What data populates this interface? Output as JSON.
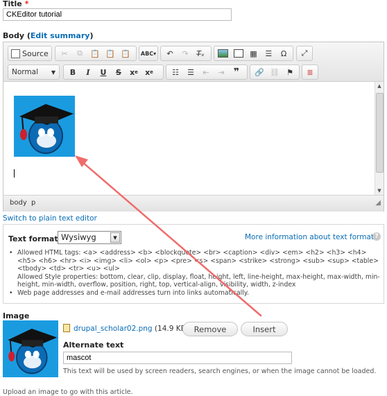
{
  "title_field": {
    "label": "Title",
    "required_mark": "*",
    "value": "CKEditor tutorial"
  },
  "body_field": {
    "label": "Body",
    "edit_summary_link": "Edit summary"
  },
  "toolbar": {
    "source_label": "Source",
    "format_select_value": "Normal"
  },
  "statusbar": {
    "path": [
      "body",
      "p"
    ]
  },
  "switch_editor_link": "Switch to plain text editor",
  "text_format": {
    "label": "Text format",
    "selected": "Wysiwyg",
    "more_info_link": "More information about text formats",
    "tips": [
      "Allowed HTML tags: <a> <address> <b> <blockquote> <br> <caption> <div> <em> <h2> <h3> <h4> <h5> <h6> <hr> <i> <img> <li> <ol> <p> <pre> <s> <span> <strike> <strong> <sub> <sup> <table> <tbody> <td> <tr> <u> <ul>",
      "Allowed Style properties: bottom, clear, clip, display, float, height, left, line-height, max-height, max-width, min-height, min-width, overflow, position, right, top, vertical-align, visibility, width, z-index",
      "Web page addresses and e-mail addresses turn into links automatically."
    ]
  },
  "image_field": {
    "label": "Image",
    "file_name": "drupal_scholar02.png",
    "file_size": "(14.9 KB)",
    "remove_label": "Remove",
    "insert_label": "Insert",
    "alt_label": "Alternate text",
    "alt_value": "mascot",
    "alt_description": "This text will be used by screen readers, search engines, or when the image cannot be loaded."
  },
  "upload_description": "Upload an image to go with this article.",
  "colors": {
    "link": "#0a6db5",
    "arrow": "#f06b6b",
    "mascot_bg": "#1a9be0"
  }
}
